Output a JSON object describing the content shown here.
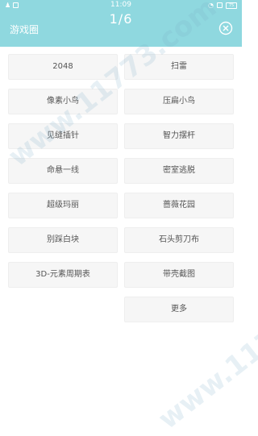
{
  "status_bar": {
    "time": "11:09",
    "battery": "75"
  },
  "header": {
    "title": "游戏圈",
    "pager": "1/6",
    "close_icon": "close-circle-icon"
  },
  "buttons": {
    "r1l": "2048",
    "r1r": "扫雷",
    "r2l": "像素小鸟",
    "r2r": "压扁小鸟",
    "r3l": "见缝插针",
    "r3r": "智力摆杆",
    "r4l": "命悬一线",
    "r4r": "密室逃脱",
    "r5l": "超级玛丽",
    "r5r": "蔷薇花园",
    "r6l": "别踩白块",
    "r6r": "石头剪刀布",
    "r7l": "3D-元素周期表",
    "r7r": "带壳截图",
    "r8r": "更多"
  },
  "watermark": "www.11773.com",
  "colors": {
    "header_bg": "#8fd8df",
    "button_bg": "#f6f6f6",
    "button_text": "#555555"
  }
}
